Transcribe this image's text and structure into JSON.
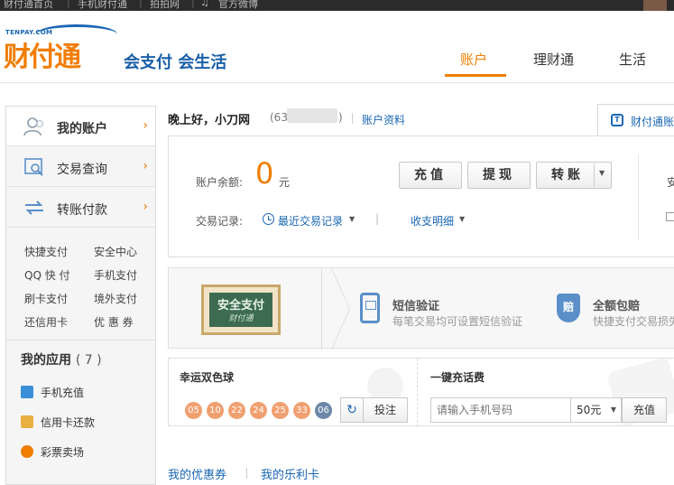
{
  "topbar": {
    "items": [
      "财付通首页",
      "手机财付通",
      "拍拍网",
      "官方微博"
    ]
  },
  "header": {
    "logo_small": "TENPAY.COM",
    "logo_main": "财付通",
    "slogan": "会支付 会生活",
    "nav": {
      "account": "账户",
      "licai": "理财通",
      "life": "生活"
    },
    "accent_color": "#f07d00",
    "brand_blue": "#1a66b3"
  },
  "sidebar": {
    "main_items": [
      {
        "label": "我的账户",
        "icon": "user-icon"
      },
      {
        "label": "交易查询",
        "icon": "search-doc-icon"
      },
      {
        "label": "转账付款",
        "icon": "transfer-arrows-icon"
      }
    ],
    "chevron": "›",
    "sub_items": [
      "快捷支付",
      "安全中心",
      "QQ 快 付",
      "手机支付",
      "刷卡支付",
      "境外支付",
      "还信用卡",
      "优 惠 券"
    ],
    "apps_title": "我的应用",
    "apps_count": "( 7 )",
    "apps": [
      {
        "label": "手机充值",
        "icon": "phone-recharge-icon"
      },
      {
        "label": "信用卡还款",
        "icon": "credit-card-icon"
      },
      {
        "label": "彩票卖场",
        "icon": "lottery-icon"
      }
    ]
  },
  "greeting": {
    "text": "晚上好，小刀网",
    "id_open": "(63",
    "id_close": ")",
    "account_info": "账户资料"
  },
  "tenpay_tab": {
    "label": "财付通账"
  },
  "balance": {
    "label": "账户余额:",
    "value": "0",
    "unit": "元",
    "buttons": {
      "charge": "充值",
      "withdraw": "提现",
      "transfer": "转账"
    },
    "cut_text": "安"
  },
  "transactions": {
    "label": "交易记录:",
    "recent": "最近交易记录",
    "separator": "|",
    "detail": "收支明细"
  },
  "security": {
    "board_title": "安全支付",
    "board_sub": "财付通",
    "sms_title": "短信验证",
    "sms_desc": "每笔交易均可设置短信验证",
    "guard_icon_text": "赔",
    "guard_title": "全额包赔",
    "guard_desc": "快捷支付交易损失"
  },
  "lottery": {
    "title": "幸运双色球",
    "red_balls": [
      "05",
      "10",
      "22",
      "24",
      "25",
      "33"
    ],
    "blue_ball": "06",
    "refresh_icon": "↻",
    "bet_label": "投注"
  },
  "recharge": {
    "title": "一键充话费",
    "phone_placeholder": "请输入手机号码",
    "amount": "50元",
    "button": "充值"
  },
  "bottom": {
    "coupon": "我的优惠券",
    "lucky": "我的乐利卡"
  }
}
